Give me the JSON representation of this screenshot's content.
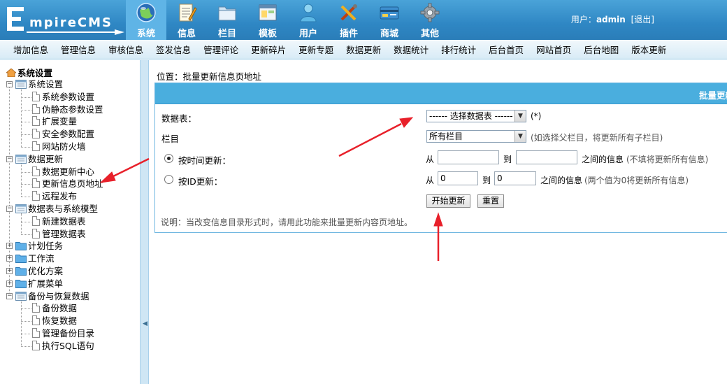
{
  "brand": {
    "letter": "E",
    "name": "mpireCMS"
  },
  "nav": [
    {
      "label": "系统",
      "icon": "globe-icon",
      "active": true
    },
    {
      "label": "信息",
      "icon": "notepad-icon",
      "active": false
    },
    {
      "label": "栏目",
      "icon": "folder-icon",
      "active": false
    },
    {
      "label": "模板",
      "icon": "window-icon",
      "active": false
    },
    {
      "label": "用户",
      "icon": "user-icon",
      "active": false
    },
    {
      "label": "插件",
      "icon": "tools-icon",
      "active": false
    },
    {
      "label": "商城",
      "icon": "card-icon",
      "active": false
    },
    {
      "label": "其他",
      "icon": "gear-icon",
      "active": false
    }
  ],
  "user": {
    "prefix": "用户：",
    "name": "admin",
    "logout": "[退出]"
  },
  "submenu": [
    "增加信息",
    "管理信息",
    "审核信息",
    "签发信息",
    "管理评论",
    "更新碎片",
    "更新专题",
    "数据更新",
    "数据统计",
    "排行统计",
    "后台首页",
    "网站首页",
    "后台地图",
    "版本更新"
  ],
  "tree": {
    "root": "系统设置",
    "groups": [
      {
        "label": "系统设置",
        "expanded": true,
        "children": [
          "系统参数设置",
          "伪静态参数设置",
          "扩展变量",
          "安全参数配置",
          "网站防火墙"
        ]
      },
      {
        "label": "数据更新",
        "expanded": true,
        "children": [
          "数据更新中心",
          "更新信息页地址",
          "远程发布"
        ]
      },
      {
        "label": "数据表与系统模型",
        "expanded": true,
        "children": [
          "新建数据表",
          "管理数据表"
        ]
      },
      {
        "label": "计划任务",
        "expanded": false,
        "children": []
      },
      {
        "label": "工作流",
        "expanded": false,
        "children": []
      },
      {
        "label": "优化方案",
        "expanded": false,
        "children": []
      },
      {
        "label": "扩展菜单",
        "expanded": false,
        "children": []
      },
      {
        "label": "备份与恢复数据",
        "expanded": true,
        "children": [
          "备份数据",
          "恢复数据",
          "管理备份目录",
          "执行SQL语句"
        ]
      }
    ]
  },
  "location": "位置：批量更新信息页地址",
  "panel": {
    "title": "批量更新",
    "table_label": "数据表：",
    "table_select": "------ 选择数据表 ------",
    "required": "(*)",
    "column_label": "栏目",
    "column_select": "所有栏目",
    "column_hint": "(如选择父栏目，将更新所有子栏目)",
    "by_time": "按时间更新：",
    "by_id": "按ID更新：",
    "from": "从",
    "to": "到",
    "between": "之间的信息",
    "time_hint": "(不填将更新所有信息)",
    "id_from": "0",
    "id_to": "0",
    "id_hint": "(两个值为0将更新所有信息)",
    "start_btn": "开始更新",
    "reset_btn": "重置",
    "note": "说明：当改变信息目录形式时，请用此功能来批量更新内容页地址。"
  },
  "colors": {
    "header": "#2f87c4",
    "accent": "#4aaede",
    "arrow": "#e8202a"
  }
}
